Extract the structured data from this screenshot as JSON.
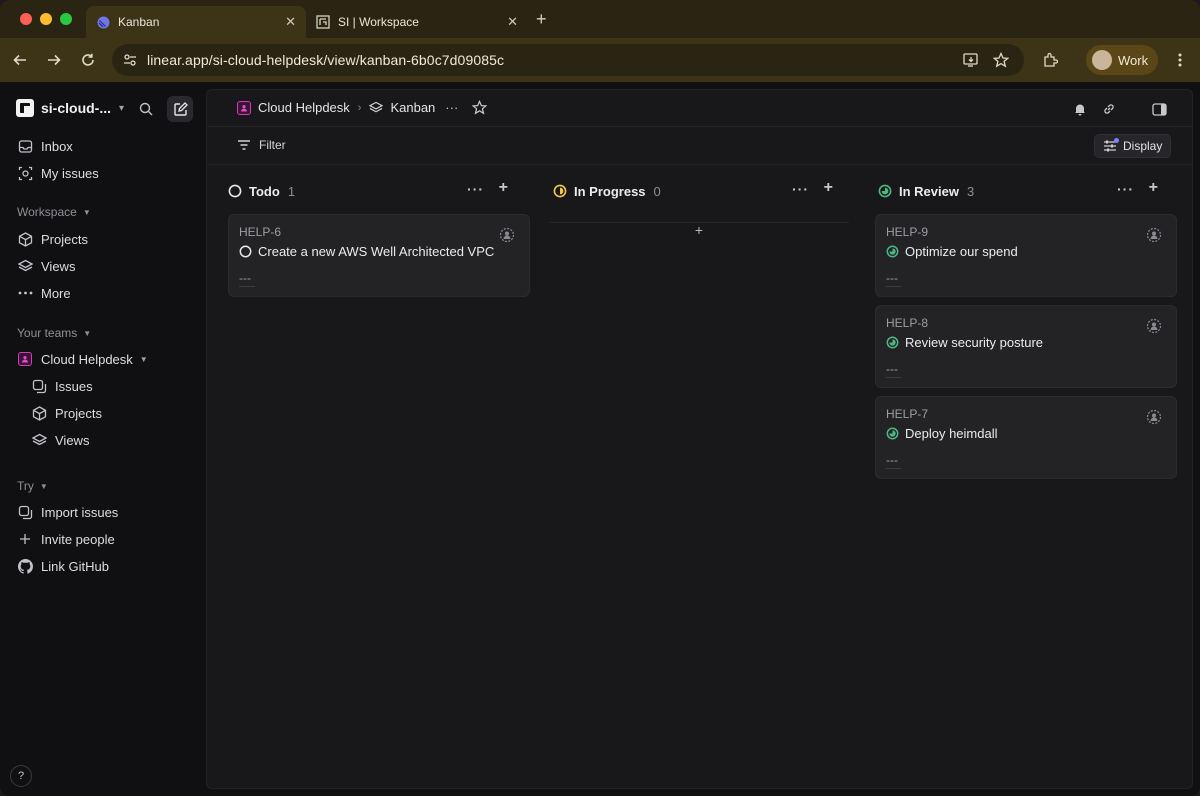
{
  "browser": {
    "tabs": [
      {
        "label": "Kanban",
        "active": true,
        "icon": "linear-logo-icon"
      },
      {
        "label": "SI | Workspace",
        "active": false,
        "icon": "si-logo-icon"
      }
    ],
    "url": "linear.app/si-cloud-helpdesk/view/kanban-6b0c7d09085c",
    "profile_label": "Work"
  },
  "sidebar": {
    "workspace_name": "si-cloud-...",
    "top_items": [
      {
        "label": "Inbox",
        "icon": "inbox-icon"
      },
      {
        "label": "My issues",
        "icon": "my-issues-icon"
      }
    ],
    "workspace_label": "Workspace",
    "workspace_items": [
      {
        "label": "Projects",
        "icon": "projects-icon"
      },
      {
        "label": "Views",
        "icon": "views-icon"
      },
      {
        "label": "More",
        "icon": "more-icon"
      }
    ],
    "teams_label": "Your teams",
    "team": {
      "name": "Cloud Helpdesk",
      "items": [
        {
          "label": "Issues",
          "icon": "issues-icon"
        },
        {
          "label": "Projects",
          "icon": "projects-icon"
        },
        {
          "label": "Views",
          "icon": "views-icon"
        }
      ]
    },
    "try_label": "Try",
    "try_items": [
      {
        "label": "Import issues",
        "icon": "import-icon"
      },
      {
        "label": "Invite people",
        "icon": "plus-icon"
      },
      {
        "label": "Link GitHub",
        "icon": "github-icon"
      }
    ],
    "help_label": "?"
  },
  "header": {
    "team_crumb": "Cloud Helpdesk",
    "view_crumb": "Kanban",
    "more_label": "···"
  },
  "filterbar": {
    "filter_label": "Filter",
    "display_label": "Display"
  },
  "board": {
    "columns": [
      {
        "name": "Todo",
        "count": "1",
        "status": "todo",
        "cards": [
          {
            "id": "HELP-6",
            "title": "Create a new AWS Well Architected VPC",
            "meta": "---"
          }
        ]
      },
      {
        "name": "In Progress",
        "count": "0",
        "status": "in-progress",
        "cards": []
      },
      {
        "name": "In Review",
        "count": "3",
        "status": "in-review",
        "cards": [
          {
            "id": "HELP-9",
            "title": "Optimize our spend",
            "meta": "---"
          },
          {
            "id": "HELP-8",
            "title": "Review security posture",
            "meta": "---"
          },
          {
            "id": "HELP-7",
            "title": "Deploy heimdall",
            "meta": "---"
          }
        ]
      }
    ],
    "add_label": "+",
    "more_label": "···"
  },
  "colors": {
    "todo": "#e8e8ea",
    "in_progress": "#f2c94c",
    "in_review": "#4cb782",
    "team_accent": "#d63ab9",
    "tab_bar": "#2a2513",
    "toolbar": "#3d3418"
  }
}
